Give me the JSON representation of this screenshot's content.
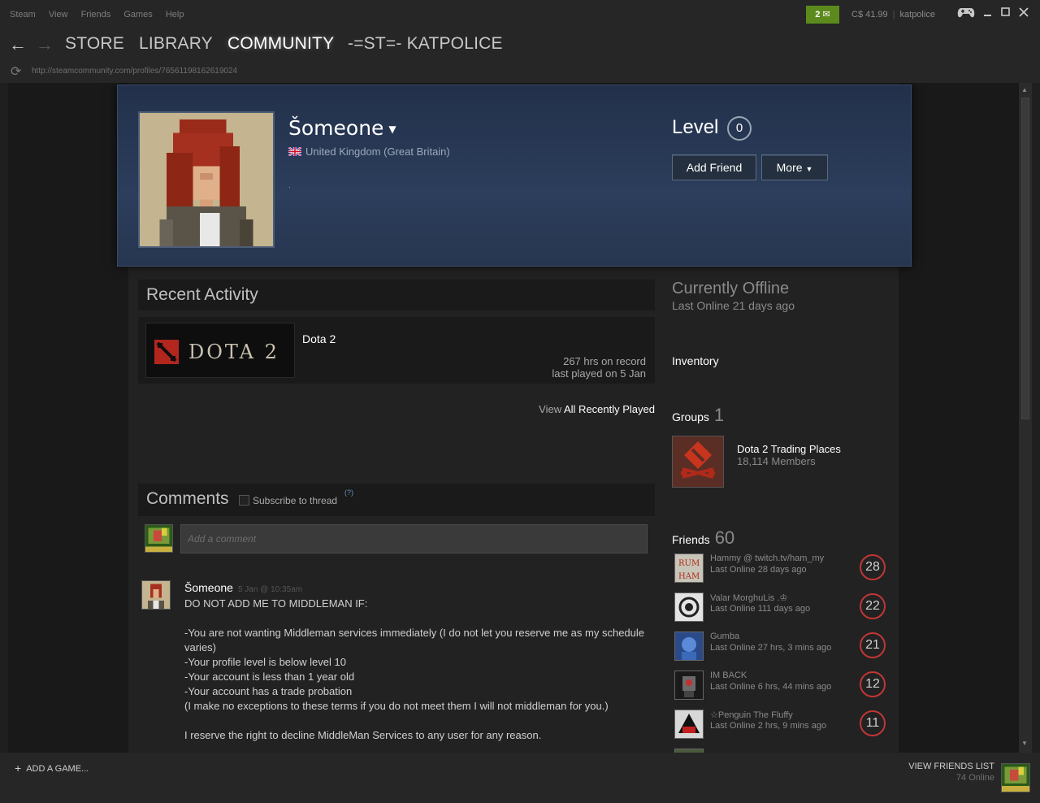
{
  "menu": [
    "Steam",
    "View",
    "Friends",
    "Games",
    "Help"
  ],
  "notifications": {
    "count": "2"
  },
  "wallet": {
    "balance": "C$ 41.99",
    "account": "katpolice"
  },
  "nav": {
    "tabs": [
      "STORE",
      "LIBRARY",
      "COMMUNITY",
      "-=ST=- KATPOLICE"
    ],
    "active": "COMMUNITY"
  },
  "url": "http://steamcommunity.com/profiles/76561198162619024",
  "profile": {
    "persona_name": "Šomeone",
    "location": "United Kingdom (Great Britain)",
    "summary": ".",
    "level_label": "Level",
    "level": "0",
    "add_friend_label": "Add Friend",
    "more_label": "More"
  },
  "recent_activity": {
    "title": "Recent Activity",
    "game": {
      "name": "Dota 2",
      "logo_text": "DOTA 2",
      "hours": "267 hrs on record",
      "last_played": "last played on 5 Jan"
    },
    "view_prefix": "View",
    "view_link": "All Recently Played"
  },
  "comments": {
    "title": "Comments",
    "subscribe_label": "Subscribe to thread",
    "help_mark": "(?)",
    "input_placeholder": "Add a comment",
    "items": [
      {
        "author": "Šomeone",
        "time": "5 Jan @ 10:35am",
        "lines": [
          "DO NOT ADD ME TO MIDDLEMAN IF:",
          "",
          "-You are not wanting Middleman services immediately (I do not let you reserve me as my schedule varies)",
          "-Your profile level is below level 10",
          "-Your account is less than 1 year old",
          "-Your account has a trade probation",
          "(I make no exceptions to these terms if you do not meet them I will not middleman for you.)",
          "",
          "I reserve the right to decline MiddleMan Services to any user for any reason."
        ]
      }
    ]
  },
  "status": {
    "title": "Currently Offline",
    "last_online": "Last Online 21 days ago"
  },
  "inventory_label": "Inventory",
  "groups": {
    "label": "Groups",
    "count": "1",
    "items": [
      {
        "name": "Dota 2 Trading Places",
        "members": "18,114 Members"
      }
    ]
  },
  "friends": {
    "label": "Friends",
    "count": "60",
    "items": [
      {
        "name": "Hammy @ twitch.tv/ham_my",
        "status": "Last Online 28 days ago",
        "level": "28",
        "avatar_color": "#b8b8b0"
      },
      {
        "name": "Valar MorghuLis .♔",
        "status": "Last Online 111 days ago",
        "level": "22",
        "avatar_color": "#d8d8d8"
      },
      {
        "name": "Gumba",
        "status": "Last Online 27 hrs, 3 mins ago",
        "level": "21",
        "avatar_color": "#3a6ab8"
      },
      {
        "name": "IM BACK",
        "status": "Last Online 6 hrs, 44 mins ago",
        "level": "12",
        "avatar_color": "#2a2a2a"
      },
      {
        "name": "☆Penguin The Fluffy",
        "status": "Last Online 2 hrs, 9 mins ago",
        "level": "11",
        "avatar_color": "#c8c8c8"
      }
    ]
  },
  "bottom": {
    "add_game": "ADD A GAME...",
    "view_friends": "VIEW FRIENDS LIST",
    "online": "74 Online"
  },
  "colors": {
    "accent_green": "#5c8a1c",
    "level_ring": "#c03636",
    "header_blue": "#2c3e5c"
  },
  "icons": [
    "back-arrow-icon",
    "forward-arrow-icon",
    "refresh-icon",
    "mail-icon",
    "gamepad-icon",
    "minimize-icon",
    "maximize-icon",
    "close-icon",
    "uk-flag-icon",
    "caret-down-icon",
    "plus-icon"
  ]
}
